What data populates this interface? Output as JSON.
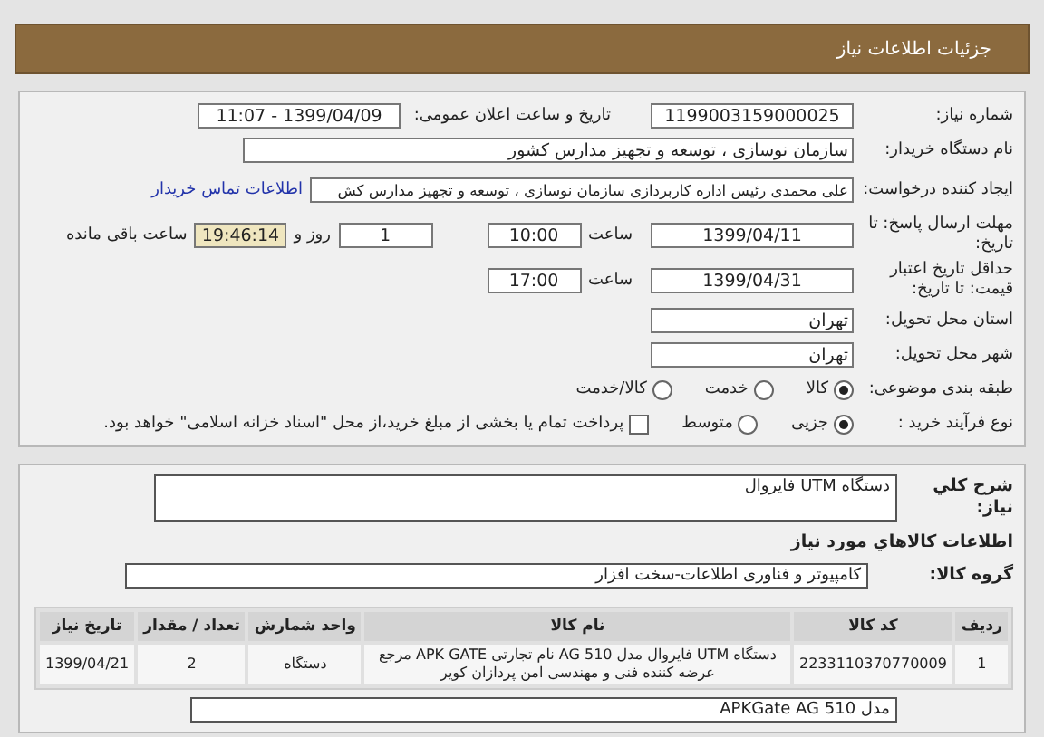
{
  "header": {
    "title": "جزئیات اطلاعات نیاز"
  },
  "details": {
    "need_number": {
      "label": "شماره نیاز:",
      "value": "1199003159000025"
    },
    "announce": {
      "label": "تاریخ و ساعت اعلان عمومی:",
      "value": "1399/04/09 - 11:07"
    },
    "buyer": {
      "label": "نام دستگاه خریدار:",
      "value": "سازمان نوسازی ، توسعه و تجهیز مدارس کشور"
    },
    "creator": {
      "label": "ایجاد کننده درخواست:",
      "value": "علی محمدی رئیس اداره کاربردازی سازمان نوسازی ، توسعه و تجهیز مدارس کش",
      "link": "اطلاعات تماس خریدار"
    },
    "deadline": {
      "label": "مهلت ارسال پاسخ: تا تاریخ:",
      "date": "1399/04/11",
      "time_label": "ساعت",
      "time": "10:00",
      "days": "1",
      "days_label": "روز و",
      "countdown": "19:46:14",
      "remaining_label": "ساعت باقی مانده"
    },
    "validity": {
      "label": "حداقل تاریخ اعتبار قیمت: تا تاریخ:",
      "date": "1399/04/31",
      "time_label": "ساعت",
      "time": "17:00"
    },
    "province": {
      "label": "استان محل تحویل:",
      "value": "تهران"
    },
    "city": {
      "label": "شهر محل تحویل:",
      "value": "تهران"
    },
    "category": {
      "label": "طبقه بندی موضوعی:",
      "options": [
        {
          "label": "کالا",
          "selected": true
        },
        {
          "label": "خدمت",
          "selected": false
        },
        {
          "label": "کالا/خدمت",
          "selected": false
        }
      ]
    },
    "process": {
      "label": "نوع فرآیند خرید :",
      "options": [
        {
          "label": "جزیی",
          "selected": true
        },
        {
          "label": "متوسط",
          "selected": false
        }
      ],
      "payment": {
        "checked": false,
        "text": "پرداخت تمام یا بخشی از مبلغ خرید،از محل \"اسناد خزانه اسلامی\" خواهد بود."
      }
    }
  },
  "summary": {
    "description": {
      "label": "شرح کلي نياز:",
      "value": "دستگاه UTM فایروال"
    },
    "goods_title": "اطلاعات کالاهاي مورد نياز",
    "group": {
      "label": "گروه کالا:",
      "value": "کامپیوتر و فناوری اطلاعات-سخت افزار"
    },
    "table": {
      "columns": [
        "ردیف",
        "کد کالا",
        "نام کالا",
        "واحد شمارش",
        "تعداد / مقدار",
        "تاریخ نیاز"
      ],
      "rows": [
        [
          "1",
          "2233110370770009",
          "دستگاه UTM فایروال مدل AG 510 نام تجارتی APK GATE مرجع عرضه کننده فنی و مهندسی امن پردازان کویر",
          "دستگاه",
          "2",
          "1399/04/21"
        ]
      ]
    },
    "note": "مدل APKGate AG 510"
  }
}
